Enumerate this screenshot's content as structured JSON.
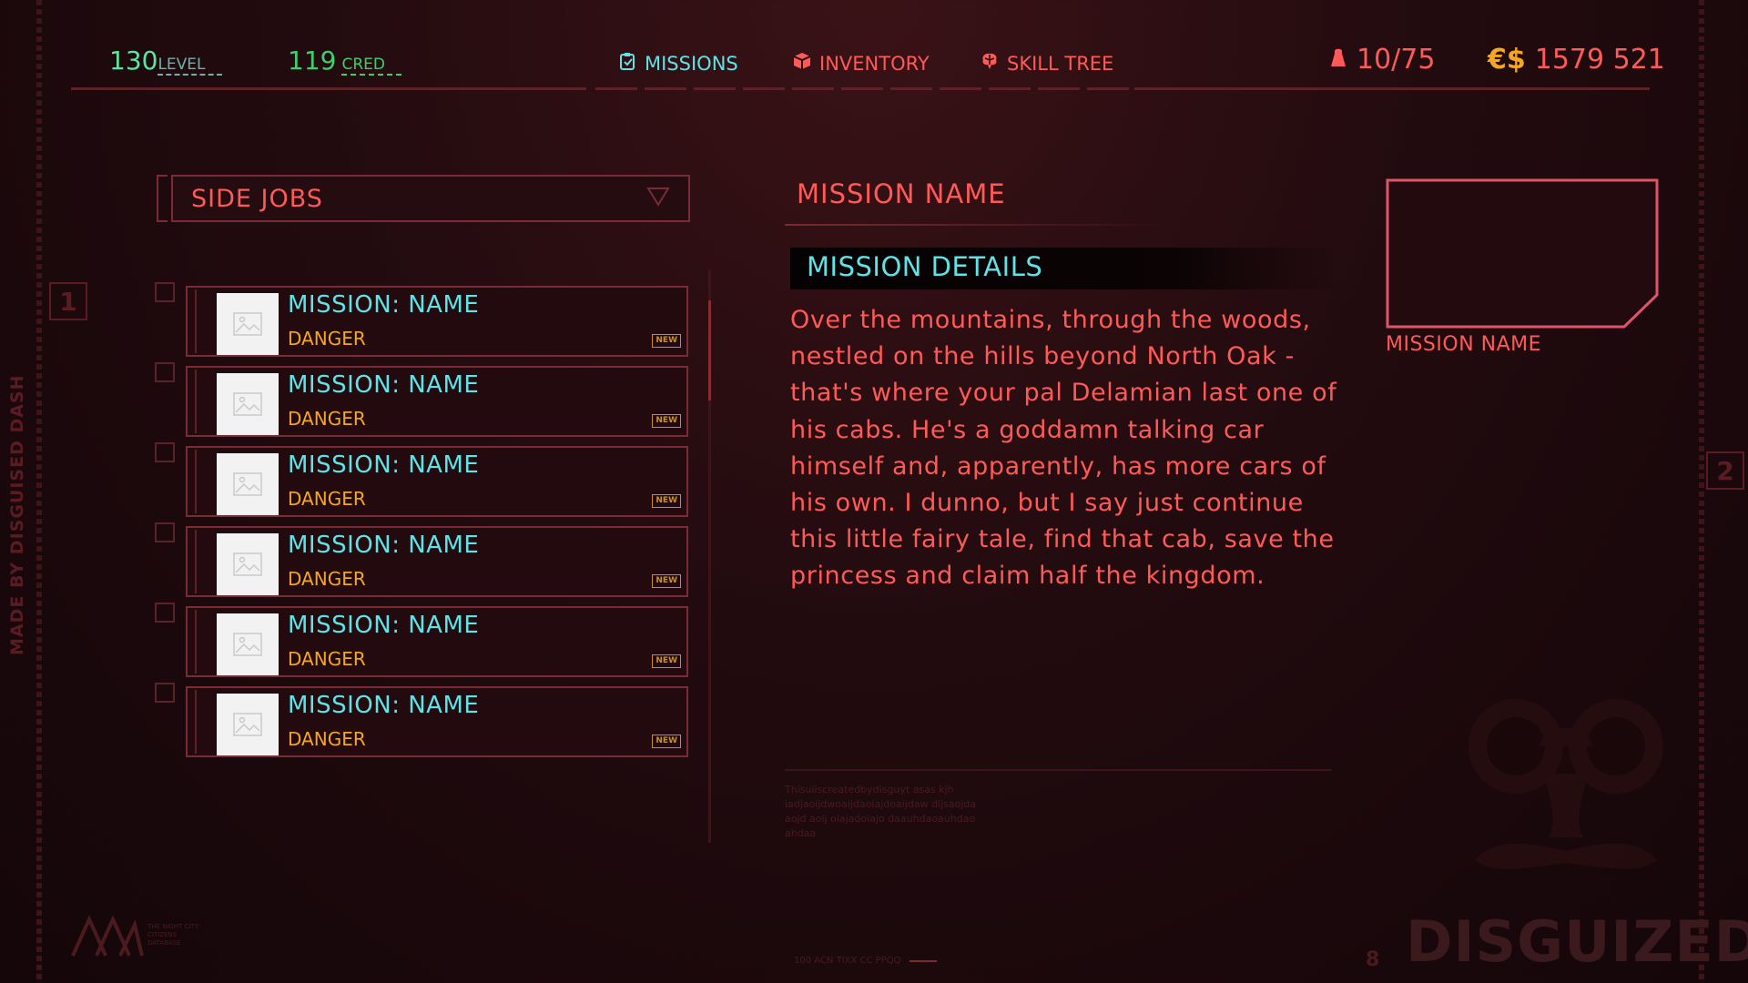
{
  "side_label": "MADE BY DISGUISED DASH",
  "side_badges": {
    "left": "1",
    "right": "2"
  },
  "header": {
    "level": {
      "value": "130",
      "label": "LEVEL"
    },
    "cred": {
      "value": "119",
      "label": "CRED"
    },
    "tabs": [
      {
        "label": "MISSIONS",
        "icon": "clipboard-icon",
        "active": true
      },
      {
        "label": "INVENTORY",
        "icon": "box-icon",
        "active": false
      },
      {
        "label": "SKILL TREE",
        "icon": "brain-icon",
        "active": false
      }
    ],
    "capacity": "10/75",
    "money_symbol": "€$",
    "money_value": "1579 521"
  },
  "filter": {
    "selected": "SIDE JOBS"
  },
  "missions": [
    {
      "title": "MISSION: NAME",
      "danger": "DANGER",
      "badge": "NEW"
    },
    {
      "title": "MISSION: NAME",
      "danger": "DANGER",
      "badge": "NEW"
    },
    {
      "title": "MISSION: NAME",
      "danger": "DANGER",
      "badge": "NEW"
    },
    {
      "title": "MISSION: NAME",
      "danger": "DANGER",
      "badge": "NEW"
    },
    {
      "title": "MISSION: NAME",
      "danger": "DANGER",
      "badge": "NEW"
    },
    {
      "title": "MISSION: NAME",
      "danger": "DANGER",
      "badge": "NEW"
    }
  ],
  "details": {
    "name": "MISSION NAME",
    "section_title": "MISSION DETAILS",
    "description": "Over the mountains, through the woods, nestled on the hills beyond North Oak - that's where your pal Delamian last one of his cabs. He's a goddamn talking car himself and, apparently, has more cars of his own. I dunno, but I say just continue this little fairy tale, find that cab, save the princess and claim half the kingdom.",
    "footnote": "Thisuiiscreatedbydisguyt asas kjh iadjaoijdwoaijdaoiajdoaijdaw dijsaojda aojd aoij oiajadoiajo daauhdaoauhdao ahdaa",
    "preview_label": "MISSION NAME"
  },
  "watermark": "DISGUIZED",
  "footer": {
    "brand_small": "THE NIGHT CITY CITIZENS DATABASE",
    "code": "100 ACN TIXX CC PPQQ",
    "page": "8"
  },
  "colors": {
    "accent_red": "#ff5a57",
    "accent_cyan": "#5fe3e6",
    "accent_orange": "#f5a623",
    "level_green": "#5fe3a0",
    "cred_green": "#3ecf6a"
  }
}
